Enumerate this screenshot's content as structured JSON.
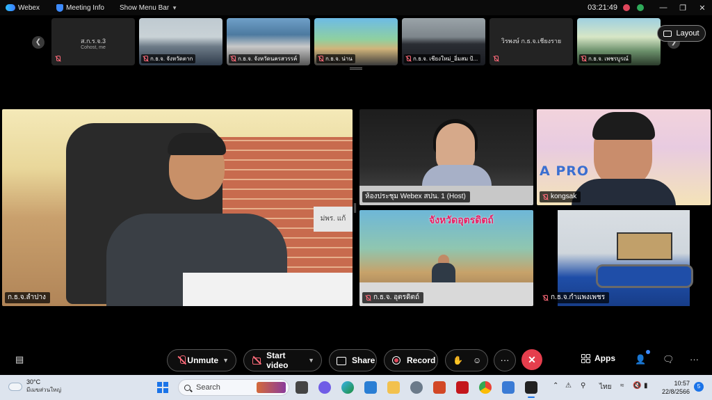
{
  "titlebar": {
    "app_name": "Webex",
    "meeting_info": "Meeting Info",
    "show_menu_bar": "Show Menu Bar",
    "clock": "03:21:49",
    "window_controls": [
      "—",
      "❐",
      "✕"
    ]
  },
  "filmstrip": {
    "prev_icon": "chevron-left-icon",
    "next_icon": "chevron-right-icon",
    "layout_label": "Layout",
    "thumbnails": [
      {
        "name": "ส.ก.ร.จ.3",
        "sub": "Cohost, me",
        "label": ""
      },
      {
        "name": "",
        "sub": "",
        "label": "ก.ธ.จ. จังหวัดตาก"
      },
      {
        "name": "",
        "sub": "",
        "label": "ก.ธ.จ. จังหวัดนครสวรรค์"
      },
      {
        "name": "",
        "sub": "",
        "label": "ก.ธ.จ. น่าน"
      },
      {
        "name": "",
        "sub": "",
        "label": "ก.ธ.จ. เชียงใหม่_อิ่มสม ป้..."
      },
      {
        "name": "วิรพงษ์ ก.ธ.จ.เชียงราย",
        "sub": "",
        "label": ""
      },
      {
        "name": "",
        "sub": "",
        "label": "ก.ธ.จ. เพชรบูรณ์"
      }
    ]
  },
  "grid": {
    "main": {
      "label": "ก.ธ.จ.ลำปาง",
      "sign": "ม่พร. แก้"
    },
    "host": {
      "label": "ห้องประชุม Webex สปน. 1 (Host)"
    },
    "kong": {
      "label": "kongsak",
      "banner": "A PRO"
    },
    "ut": {
      "label": "ก.ธ.จ. อุตรดิตถ์",
      "banner": "จังหวัดอุตรดิตถ์"
    },
    "kp": {
      "label": "ก.ธ.จ.กำแพงเพชร"
    }
  },
  "controls": {
    "unmute": "Unmute",
    "start_video": "Start video",
    "share": "Share",
    "record": "Record",
    "more": "···",
    "leave": "✕",
    "apps": "Apps",
    "overflow": "···"
  },
  "taskbar": {
    "temperature": "30°C",
    "weather_desc": "มีเมฆส่วนใหญ่",
    "search_placeholder": "Search",
    "language": "ไทย",
    "time": "10:57",
    "date": "22/8/2566",
    "notifications": "5"
  },
  "colors": {
    "leave_red": "#e53e4d",
    "muted_red": "#ff6b7a",
    "accent_blue": "#1a73e8"
  }
}
